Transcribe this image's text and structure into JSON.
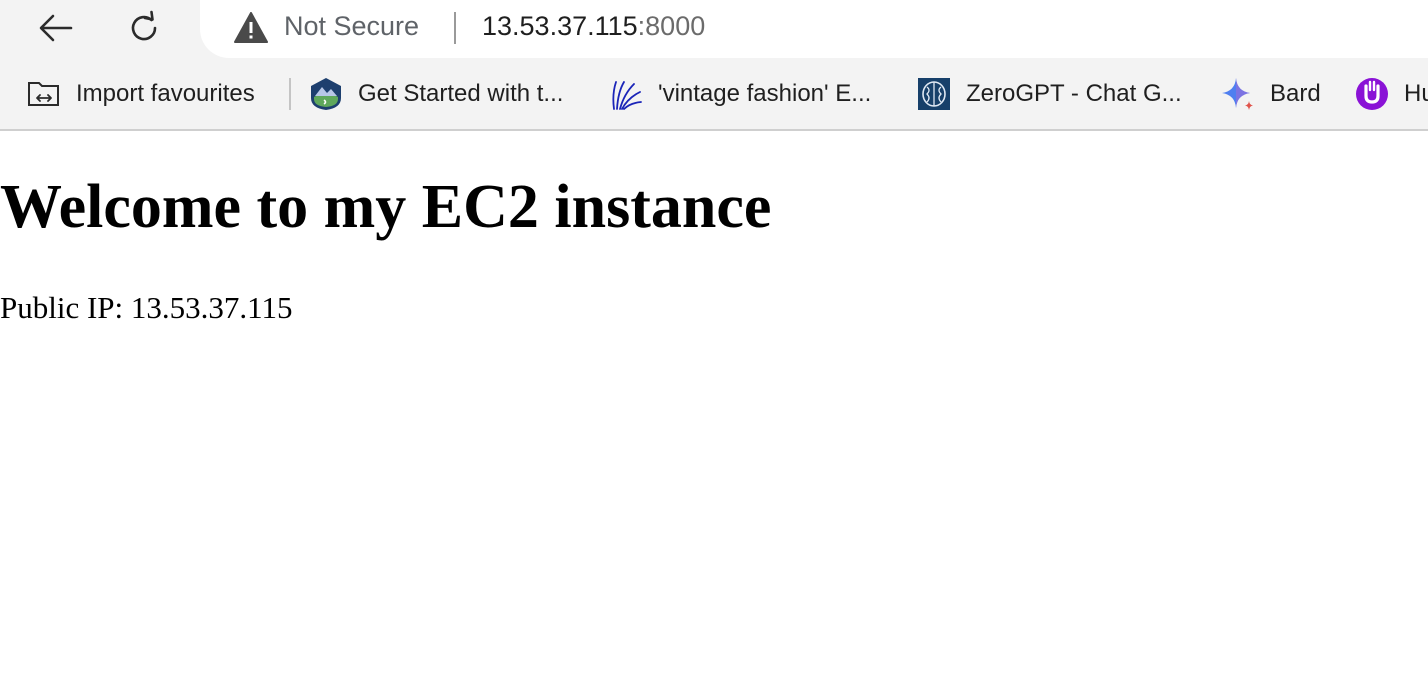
{
  "browser": {
    "security_label": "Not Secure",
    "url_host": "13.53.37.115",
    "url_port": ":8000",
    "bookmarks": [
      {
        "label": "Import favourites",
        "icon": "import-favourites-icon"
      },
      {
        "label": "Get Started with t...",
        "icon": "trailhead-icon"
      },
      {
        "label": "'vintage fashion' E...",
        "icon": "lines-logo-icon"
      },
      {
        "label": "ZeroGPT - Chat G...",
        "icon": "brain-icon"
      },
      {
        "label": "Bard",
        "icon": "sparkle-icon"
      },
      {
        "label": "Hu",
        "icon": "hu-logo-icon"
      }
    ]
  },
  "page": {
    "title": "Welcome to my EC2 instance",
    "public_ip": "Public IP: 13.53.37.115"
  },
  "colors": {
    "toolbar_bg": "#f3f3f3",
    "address_bg": "#ffffff",
    "text_secondary": "#5f6368",
    "text_primary": "#1f1f1f"
  }
}
